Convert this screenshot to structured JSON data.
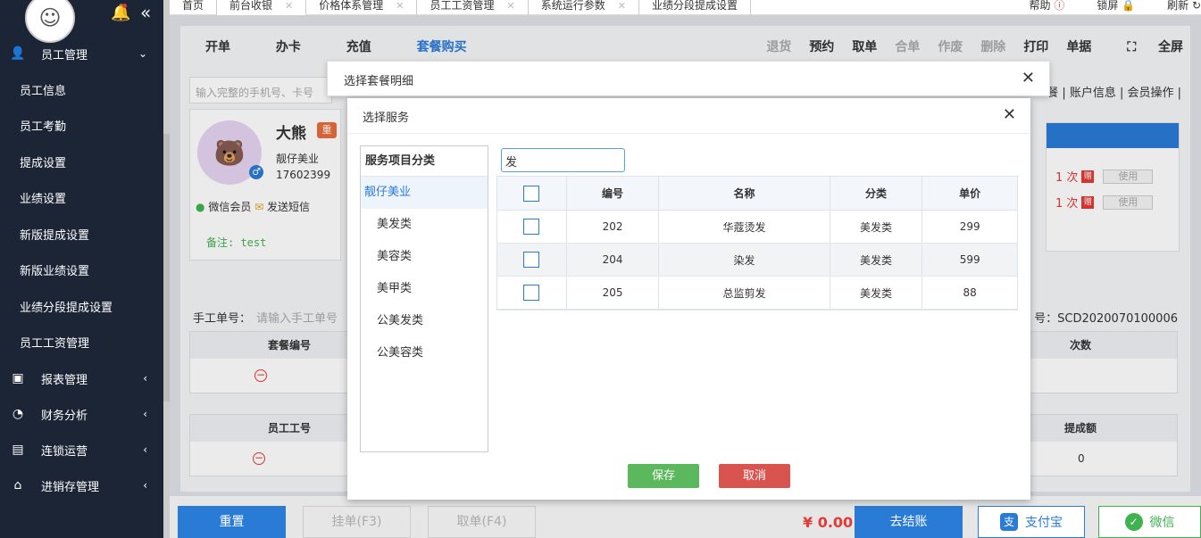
{
  "sidebar": {
    "nav_main": "员工管理",
    "items": [
      "员工信息",
      "员工考勤",
      "提成设置",
      "业绩设置",
      "新版提成设置",
      "新版业绩设置",
      "业绩分段提成设置",
      "员工工资管理"
    ],
    "groups": [
      "报表管理",
      "财务分析",
      "连锁运营",
      "进销存管理"
    ]
  },
  "tabs": [
    {
      "label": "首页"
    },
    {
      "label": "前台收银"
    },
    {
      "label": "价格体系管理"
    },
    {
      "label": "员工工资管理"
    },
    {
      "label": "系统运行参数"
    },
    {
      "label": "业绩分段提成设置"
    }
  ],
  "top_right": {
    "help": "帮助",
    "lock": "锁屏",
    "refresh": "刷新"
  },
  "action_bar": {
    "left": [
      "开单",
      "办卡",
      "充值",
      "套餐购买"
    ],
    "right": [
      "退货",
      "预约",
      "取单",
      "合单",
      "作废",
      "删除",
      "打印",
      "单据",
      "全屏"
    ]
  },
  "search": {
    "phone_placeholder": "输入完整的手机号、卡号"
  },
  "account_links": "餐 | 账户信息 | 会员操作 |",
  "member": {
    "name": "大熊",
    "tag": "重",
    "shop": "靓仔美业",
    "phone": "17602399",
    "wechat": "微信会员",
    "sms": "发送短信",
    "note": "备注: test"
  },
  "counts": [
    {
      "count": "1 次",
      "use": "使用"
    },
    {
      "count": "1 次",
      "use": "使用"
    }
  ],
  "manual": {
    "label": "手工单号：",
    "placeholder": "请输入手工单号"
  },
  "order_no": "号：SCD2020070100006",
  "bg_table1": {
    "col1": "套餐编号",
    "col2": "次数"
  },
  "bg_table2": {
    "col1": "员工工号",
    "col2": "提成额",
    "value": "0"
  },
  "bottom": {
    "reset": "重置",
    "hang": "挂单(F3)",
    "take": "取单(F4)",
    "total": "¥ 0.00",
    "checkout": "去结账",
    "alipay": "支付宝",
    "wechat": "微信"
  },
  "dialog_outer": {
    "title": "选择套餐明细"
  },
  "dialog_inner": {
    "title": "选择服务",
    "category_header": "服务项目分类",
    "categories": [
      "靓仔美业",
      "美发类",
      "美容类",
      "美甲类",
      "公美发类",
      "公美容类"
    ],
    "search_value": "发",
    "columns": [
      "编号",
      "名称",
      "分类",
      "单价"
    ],
    "rows": [
      {
        "no": "202",
        "name": "华蔻烫发",
        "category": "美发类",
        "price": "299"
      },
      {
        "no": "204",
        "name": "染发",
        "category": "美发类",
        "price": "599"
      },
      {
        "no": "205",
        "name": "总监剪发",
        "category": "美发类",
        "price": "88"
      }
    ],
    "save": "保存",
    "cancel": "取消"
  }
}
